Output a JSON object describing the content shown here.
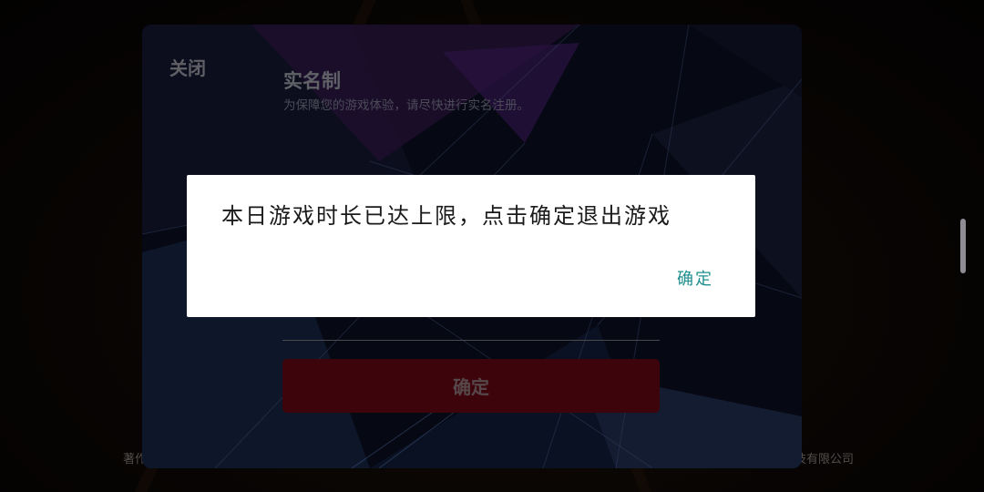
{
  "panel": {
    "close_label": "关闭",
    "title": "实名制",
    "subtitle": "为保障您的游戏体验，请尽快进行实名注册。",
    "confirm_label": "确定"
  },
  "footer": {
    "left_text": "著作",
    "right_text": "技有限公司"
  },
  "dialog": {
    "message": "本日游戏时长已达上限，点击确定退出游戏",
    "ok_label": "确定"
  },
  "colors": {
    "confirm_button": "#5a0613",
    "dialog_ok": "#1f8e8e",
    "panel_bg": "#0b0e1e"
  }
}
